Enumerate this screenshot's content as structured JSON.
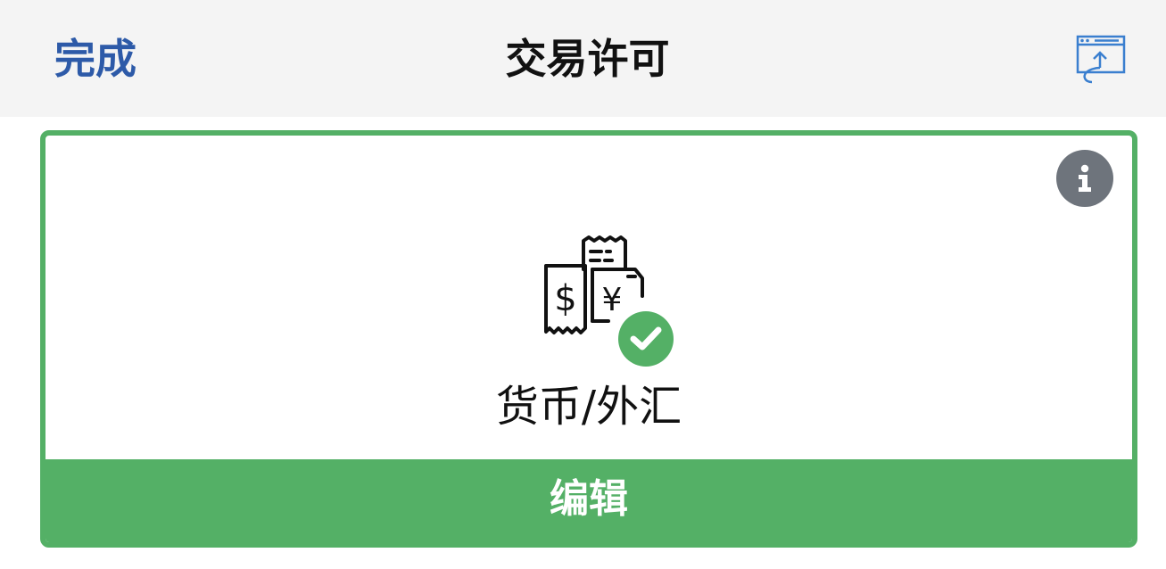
{
  "navbar": {
    "done_label": "完成",
    "title": "交易许可",
    "export_icon": "share-export-icon"
  },
  "card": {
    "info_icon": "info-icon",
    "category_icon": "currency-receipts-icon",
    "check_icon": "check-circle-icon",
    "category_label": "货币/外汇",
    "edit_label": "编辑"
  },
  "colors": {
    "accent_blue": "#2d5aa8",
    "success_green": "#54b066",
    "info_gray": "#6e747c",
    "navbar_bg": "#f4f4f4"
  }
}
